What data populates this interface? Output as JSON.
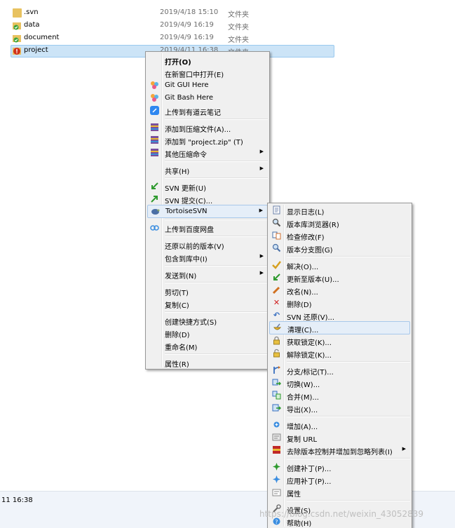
{
  "files": [
    {
      "name": ".svn",
      "date": "2019/4/18 15:10",
      "type": "文件夹",
      "icon": "folder-icon"
    },
    {
      "name": "data",
      "date": "2019/4/9 16:19",
      "type": "文件夹",
      "icon": "svn-folder-ok-icon"
    },
    {
      "name": "document",
      "date": "2019/4/9 16:19",
      "type": "文件夹",
      "icon": "svn-folder-ok-icon"
    },
    {
      "name": "project",
      "date": "2019/4/11 16:38",
      "type": "文件夹",
      "icon": "svn-folder-modified-icon",
      "selected": true
    }
  ],
  "status_text": "11 16:38",
  "context_menu": {
    "items": [
      "打开(O)",
      "在新窗口中打开(E)",
      "Git GUI Here",
      "Git Bash Here",
      "上传到有道云笔记",
      "添加到压缩文件(A)...",
      "添加到 \"project.zip\" (T)",
      "其他压缩命令",
      "共享(H)",
      "SVN 更新(U)",
      "SVN 提交(C)...",
      "TortoiseSVN",
      "上传到百度网盘",
      "还原以前的版本(V)",
      "包含到库中(I)",
      "发送到(N)",
      "剪切(T)",
      "复制(C)",
      "创建快捷方式(S)",
      "删除(D)",
      "重命名(M)",
      "属性(R)"
    ]
  },
  "svn_submenu": {
    "items": [
      "显示日志(L)",
      "版本库浏览器(R)",
      "检查修改(F)",
      "版本分支图(G)",
      "解决(O)...",
      "更新至版本(U)...",
      "改名(N)...",
      "删除(D)",
      "SVN 还原(V)...",
      "清理(C)...",
      "获取锁定(K)...",
      "解除锁定(K)...",
      "分支/标记(T)...",
      "切换(W)...",
      "合并(M)...",
      "导出(X)...",
      "增加(A)...",
      "复制 URL",
      "去除版本控制并增加到忽略列表(I)",
      "创建补丁(P)...",
      "应用补丁(P)...",
      "属性",
      "设置(S)",
      "帮助(H)"
    ]
  },
  "watermark": "https://blog.csdn.net/weixin_43052839",
  "colors": {
    "selection": "#cce4f7",
    "menu_bg": "#f0f0f0",
    "menu_highlight": "#e5eef8"
  }
}
